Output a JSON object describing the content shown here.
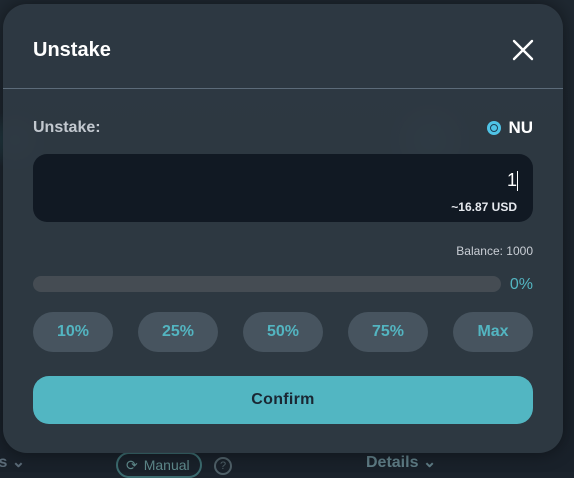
{
  "background": {
    "left_fragment": "ls ⌄",
    "manual_label": "Manual",
    "help_glyph": "?",
    "details_label": "Details ⌄"
  },
  "modal": {
    "title": "Unstake",
    "close_icon": "close-icon",
    "field_label": "Unstake:",
    "token": {
      "symbol": "NU",
      "icon": "nu-token-icon",
      "color": "#4fc3e6"
    },
    "amount_value": "1",
    "usd_value": "~16.87 USD",
    "balance": "Balance: 1000",
    "slider": {
      "percent": 0,
      "display": "0%"
    },
    "percent_buttons": [
      "10%",
      "25%",
      "50%",
      "75%",
      "Max"
    ],
    "confirm_label": "Confirm",
    "accent_color": "#53b5c1"
  }
}
